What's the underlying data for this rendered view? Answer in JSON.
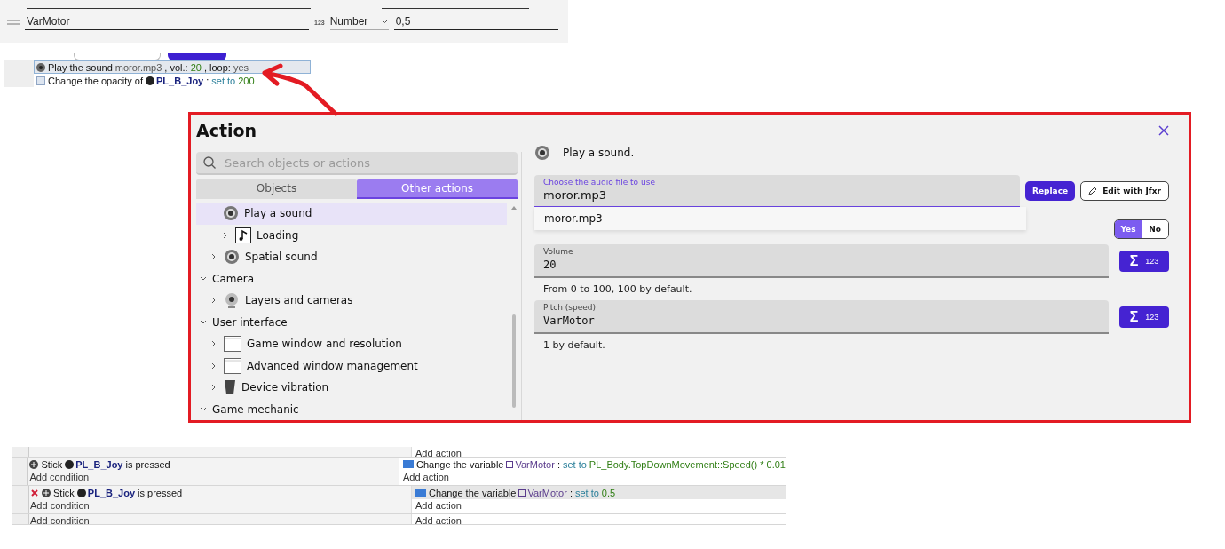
{
  "variable_editor": {
    "name": "VarMotor",
    "type_badge": "123",
    "type": "Number",
    "value": "0,5"
  },
  "event_snippet": {
    "rows": [
      {
        "selected": true,
        "kind": "sound",
        "segments": [
          {
            "kind": "plain",
            "text": "Play the sound"
          },
          {
            "kind": "param",
            "text": "moror.mp3"
          },
          {
            "kind": "plain",
            "text": ", vol.:"
          },
          {
            "kind": "value",
            "text": "20"
          },
          {
            "kind": "plain",
            "text": ", loop:"
          },
          {
            "kind": "param",
            "text": "yes"
          }
        ]
      },
      {
        "selected": false,
        "kind": "opacity",
        "segments": [
          {
            "kind": "plain",
            "text": "Change the opacity of"
          },
          {
            "kind": "object",
            "text": "PL_B_Joy"
          },
          {
            "kind": "plain",
            "text": ":"
          },
          {
            "kind": "op",
            "text": "set to"
          },
          {
            "kind": "value",
            "text": "200"
          }
        ]
      }
    ]
  },
  "dialog": {
    "title": "Action",
    "search": {
      "placeholder": "Search objects or actions"
    },
    "tabs": [
      {
        "label": "Objects",
        "selected": false
      },
      {
        "label": "Other actions",
        "selected": true
      }
    ],
    "tree": [
      {
        "children": [
          {
            "children": [
              {
                "label": "Play a sound",
                "kind": "speaker",
                "selected": true
              },
              {
                "label": "Loading",
                "kind": "note",
                "selected": false,
                "expanded": false
              }
            ]
          },
          {
            "label": "Spatial sound",
            "kind": "speaker",
            "selected": false,
            "expanded": false
          }
        ]
      },
      {
        "label": "Camera",
        "expanded": true,
        "children": [
          {
            "label": "Layers and cameras",
            "kind": "webcam",
            "selected": false,
            "expanded": false
          }
        ]
      },
      {
        "label": "User interface",
        "expanded": true,
        "children": [
          {
            "label": "Game window and resolution",
            "kind": "window",
            "selected": false,
            "expanded": false
          },
          {
            "label": "Advanced window management",
            "kind": "window",
            "selected": false,
            "expanded": false
          },
          {
            "label": "Device vibration",
            "kind": "phone",
            "selected": false,
            "expanded": false
          }
        ]
      },
      {
        "label": "Game mechanic",
        "expanded": true
      }
    ],
    "description": "Play a sound.",
    "file_field": {
      "label": "Choose the audio file to use",
      "value": "moror.mp3",
      "suggestions": [
        "moror.mp3"
      ]
    },
    "replace_button": "Replace",
    "jfxr_button": "Edit with Jfxr",
    "repeat_toggle": [
      {
        "label": "Yes",
        "selected": true
      },
      {
        "label": "No",
        "selected": false
      }
    ],
    "params": [
      {
        "label": "Volume",
        "value": "20",
        "help": "From 0 to 100, 100 by default.",
        "button_symbol": "Σ",
        "button_label": "123"
      },
      {
        "label": "Pitch (speed)",
        "value": "VarMotor",
        "help": "1 by default.",
        "button_symbol": "Σ",
        "button_label": "123"
      }
    ]
  },
  "events": [
    {
      "add_action": "Add action"
    },
    {
      "selected": false,
      "inverted": false,
      "conditions": [
        [
          {
            "kind": "plain",
            "text": "Stick"
          },
          {
            "kind": "object",
            "text": "PL_B_Joy"
          },
          {
            "kind": "plain",
            "text": "is pressed"
          }
        ]
      ],
      "add_condition": "Add condition",
      "actions": [
        [
          {
            "kind": "plain",
            "text": "Change the variable"
          },
          {
            "kind": "variable",
            "text": "VarMotor"
          },
          {
            "kind": "plain",
            "text": ":"
          },
          {
            "kind": "op",
            "text": "set to"
          },
          {
            "kind": "value",
            "text": "PL_Body.TopDownMovement::Speed() * 0.01"
          }
        ]
      ],
      "add_action": "Add action"
    },
    {
      "selected": true,
      "inverted": true,
      "conditions": [
        [
          {
            "kind": "plain",
            "text": "Stick"
          },
          {
            "kind": "object",
            "text": "PL_B_Joy"
          },
          {
            "kind": "plain",
            "text": "is pressed"
          }
        ]
      ],
      "add_condition": "Add condition",
      "actions": [
        [
          {
            "kind": "plain",
            "text": "Change the variable"
          },
          {
            "kind": "variable",
            "text": "VarMotor"
          },
          {
            "kind": "plain",
            "text": ":"
          },
          {
            "kind": "op",
            "text": "set to"
          },
          {
            "kind": "value",
            "text": "0.5"
          }
        ]
      ],
      "add_action": "Add action"
    },
    {
      "add_condition": "Add condition",
      "add_action": "Add action"
    }
  ]
}
